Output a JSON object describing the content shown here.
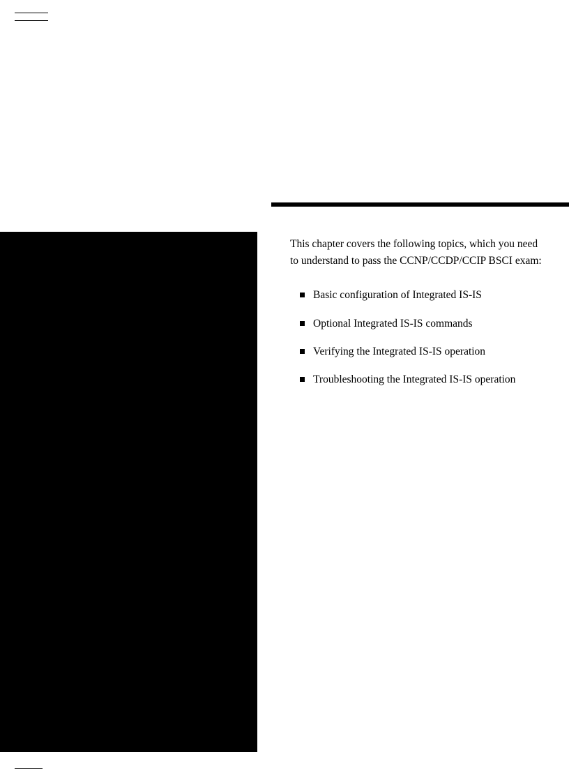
{
  "intro": "This chapter covers the following topics, which you need to understand to pass the CCNP/CCDP/CCIP BSCI exam:",
  "topics": [
    "Basic configuration of Integrated IS-IS",
    "Optional Integrated IS-IS commands",
    "Verifying the Integrated IS-IS operation",
    "Troubleshooting the Integrated IS-IS operation"
  ]
}
